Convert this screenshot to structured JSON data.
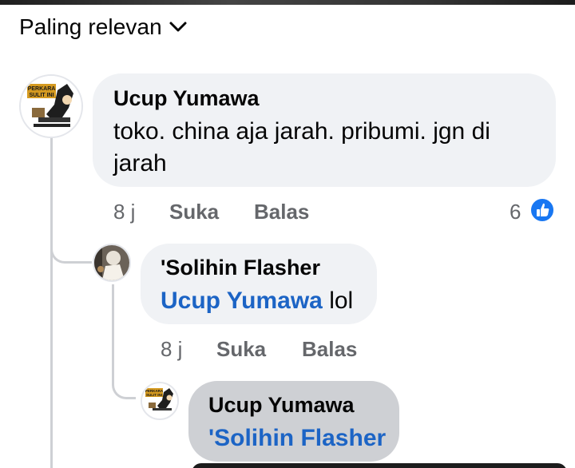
{
  "header": {
    "sort_label": "Paling relevan",
    "sort_icon": "chevron-down-icon"
  },
  "comments": [
    {
      "author": "Ucup Yumawa",
      "avatar_text": "PERKARA SULIT INI",
      "text_line1": "toko. china aja jarah. pribumi. jgn di",
      "text_line2": "jarah",
      "time": "8 j",
      "like_label": "Suka",
      "reply_label": "Balas",
      "reaction_count": "6",
      "reaction_icon": "like-icon"
    },
    {
      "author": "'Solihin Flasher",
      "mention": "Ucup Yumawa",
      "text_after_mention": " lol",
      "time": "8 j",
      "like_label": "Suka",
      "reply_label": "Balas"
    },
    {
      "author": "Ucup Yumawa",
      "avatar_text": "PERKARA SULIT INI",
      "mention": "'Solihin Flasher"
    }
  ],
  "colors": {
    "bubble": "#f0f2f5",
    "bubble_highlight": "#ced0d4",
    "mention": "#1c64c5",
    "meta": "#65676b",
    "like_blue": "#1877f2"
  }
}
